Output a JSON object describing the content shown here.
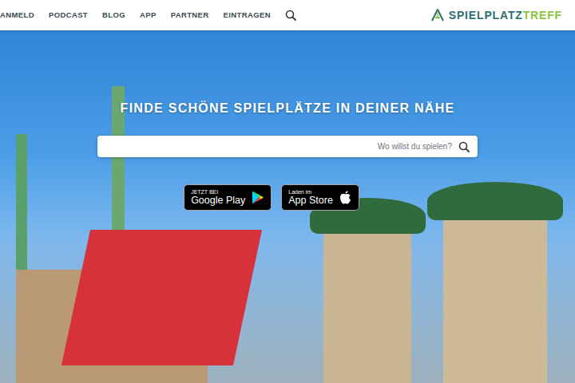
{
  "nav": {
    "items": [
      "ANMELD",
      "PODCAST",
      "BLOG",
      "APP",
      "PARTNER",
      "EINTRAGEN"
    ],
    "logo": {
      "part1": "SPIELPLATZ",
      "part2": "TREFF"
    }
  },
  "hero": {
    "heading": "FINDE SCHÖNE SPIELPLÄTZE IN DEINER NÄHE",
    "search": {
      "placeholder": "Wo willst du spielen?"
    },
    "badges": [
      {
        "line1": "JETZT BEI",
        "line2": "Google Play",
        "kind": "google"
      },
      {
        "line1": "Laden im",
        "line2": "App Store",
        "kind": "apple"
      }
    ]
  }
}
